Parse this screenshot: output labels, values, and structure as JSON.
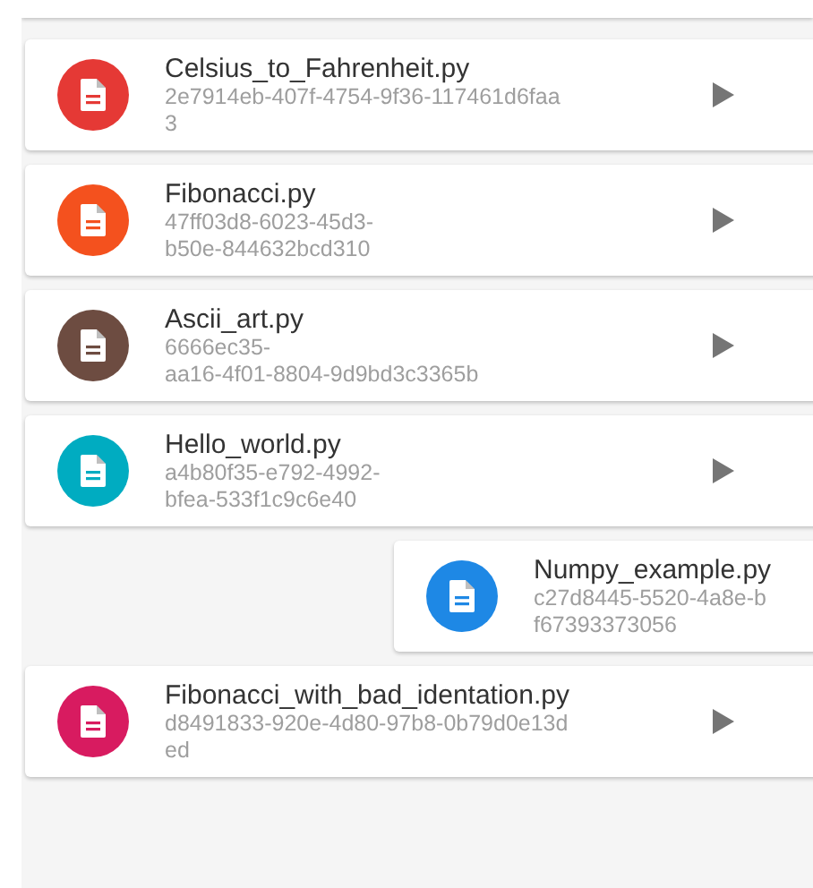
{
  "scripts": [
    {
      "name": "Celsius_to_Fahrenheit.py",
      "id_lines": [
        "2e7914eb-407f-4754-9f36-117461d6faa",
        "3"
      ],
      "color": "#e53935",
      "swiped": false
    },
    {
      "name": "Fibonacci.py",
      "id_lines": [
        "47ff03d8-6023-45d3-",
        "b50e-844632bcd310"
      ],
      "color": "#f4511e",
      "swiped": false
    },
    {
      "name": "Ascii_art.py",
      "id_lines": [
        "6666ec35-",
        "aa16-4f01-8804-9d9bd3c3365b"
      ],
      "color": "#6d4c41",
      "swiped": false
    },
    {
      "name": "Hello_world.py",
      "id_lines": [
        "a4b80f35-e792-4992-",
        "bfea-533f1c9c6e40"
      ],
      "color": "#00acc1",
      "swiped": false
    },
    {
      "name": "Numpy_example.py",
      "id_lines": [
        "c27d8445-5520-4a8e-b",
        "f67393373056"
      ],
      "color": "#1e88e5",
      "swiped": true
    },
    {
      "name": "Fibonacci_with_bad_identation.py",
      "id_lines": [
        "d8491833-920e-4d80-97b8-0b79d0e13d",
        "ed"
      ],
      "color": "#d81b60",
      "swiped": false
    }
  ]
}
